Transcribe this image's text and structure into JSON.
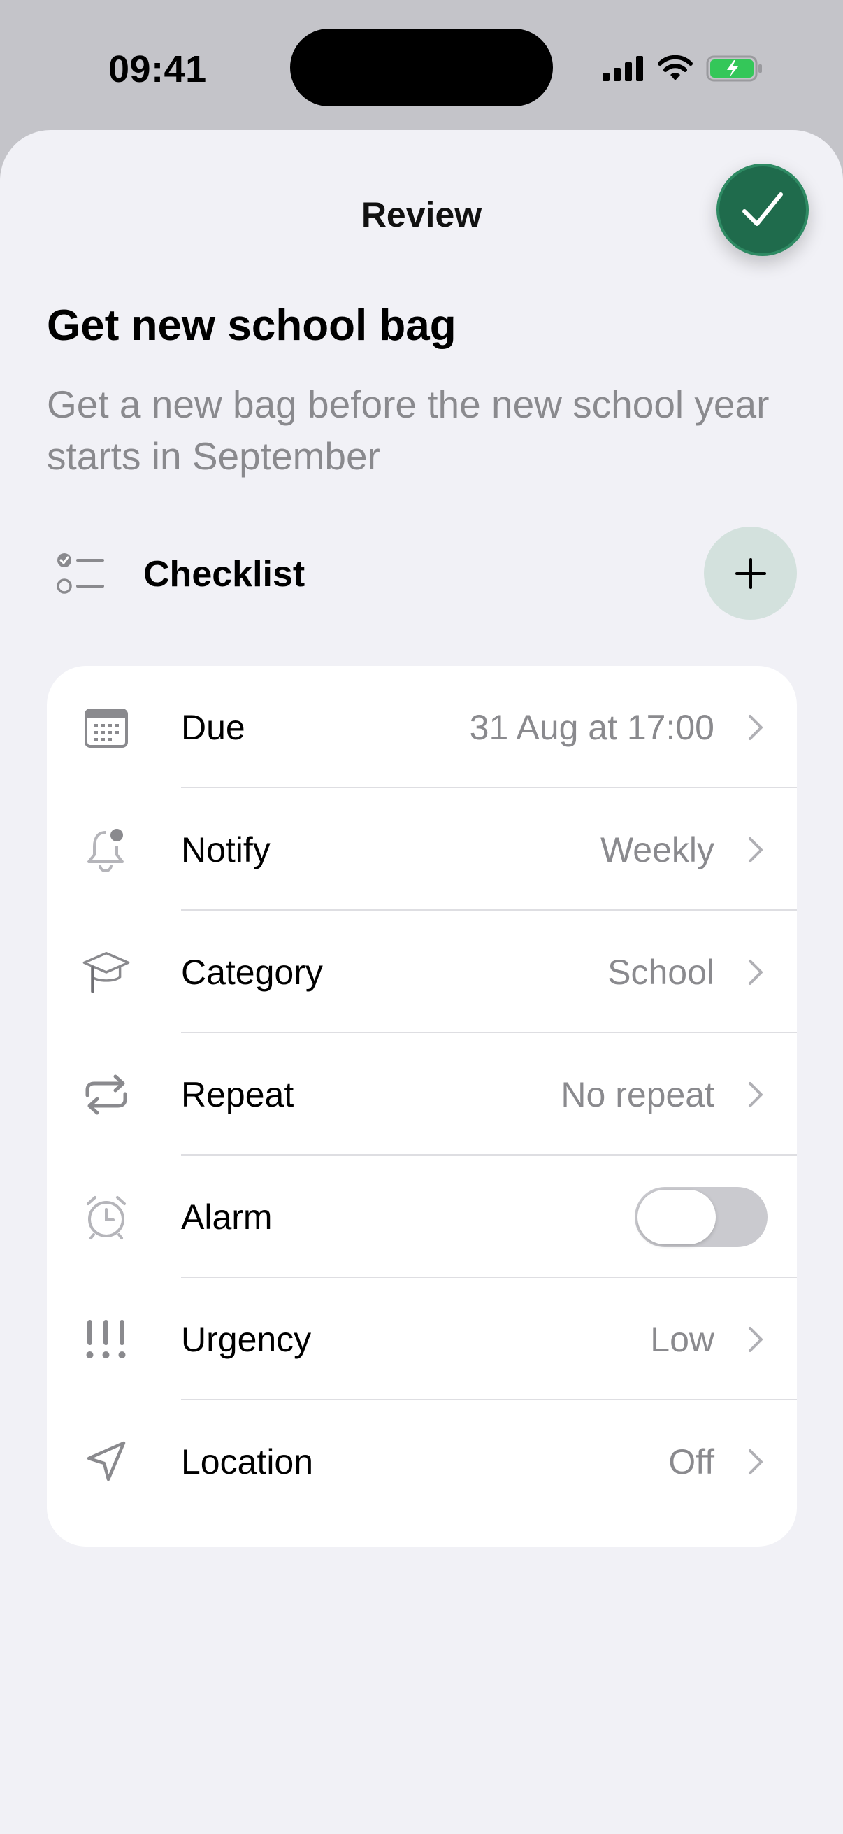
{
  "status_bar": {
    "time": "09:41"
  },
  "header": {
    "title": "Review",
    "done_icon": "checkmark-icon",
    "accent_color": "#1f6b4c"
  },
  "task": {
    "title": "Get new school bag",
    "description": "Get a new bag before the new school year starts in September"
  },
  "checklist": {
    "label": "Checklist",
    "icon": "checklist-icon",
    "add_icon": "plus-icon"
  },
  "settings": [
    {
      "key": "due",
      "label": "Due",
      "value": "31 Aug at 17:00",
      "icon": "calendar-icon"
    },
    {
      "key": "notify",
      "label": "Notify",
      "value": "Weekly",
      "icon": "bell-icon"
    },
    {
      "key": "category",
      "label": "Category",
      "value": "School",
      "icon": "graduation-cap-icon"
    },
    {
      "key": "repeat",
      "label": "Repeat",
      "value": "No repeat",
      "icon": "repeat-icon"
    },
    {
      "key": "alarm",
      "label": "Alarm",
      "toggle_on": false,
      "icon": "alarm-clock-icon"
    },
    {
      "key": "urgency",
      "label": "Urgency",
      "value": "Low",
      "icon": "exclamation-icon"
    },
    {
      "key": "location",
      "label": "Location",
      "value": "Off",
      "icon": "location-arrow-icon"
    }
  ]
}
